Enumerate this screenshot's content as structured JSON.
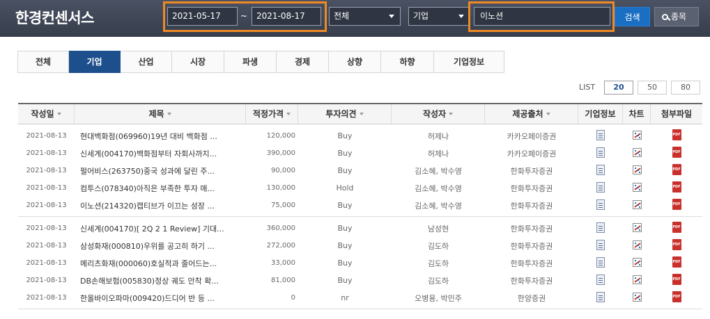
{
  "header": {
    "logo": "한경컨센서스",
    "date_from": "2021-05-17",
    "date_separator": "~",
    "date_to": "2021-08-17",
    "category_select": "전체",
    "type_select": "기업",
    "search_value": "이노션",
    "search_button": "검색",
    "stock_button": "종목"
  },
  "tabs": [
    {
      "label": "전체",
      "active": false
    },
    {
      "label": "기업",
      "active": true
    },
    {
      "label": "산업",
      "active": false
    },
    {
      "label": "시장",
      "active": false
    },
    {
      "label": "파생",
      "active": false
    },
    {
      "label": "경제",
      "active": false
    },
    {
      "label": "상향",
      "active": false
    },
    {
      "label": "하향",
      "active": false
    },
    {
      "label": "기업정보",
      "active": false
    }
  ],
  "list": {
    "label": "LIST",
    "options": [
      "20",
      "50",
      "80"
    ],
    "active": "20"
  },
  "columns": [
    "작성일",
    "제목",
    "적정가격",
    "투자의견",
    "작성자",
    "제공출처",
    "기업정보",
    "차트",
    "첨부파일"
  ],
  "groups": [
    [
      {
        "date": "2021-08-13",
        "title": "현대백화점(069960)19년 대비 백화점 ...",
        "price": "120,000",
        "opinion": "Buy",
        "author": "허제나",
        "source": "카카오페이증권"
      },
      {
        "date": "2021-08-13",
        "title": "신세계(004170)백화점부터 자회사까지...",
        "price": "390,000",
        "opinion": "Buy",
        "author": "허제나",
        "source": "카카오페이증권"
      },
      {
        "date": "2021-08-13",
        "title": "펄어비스(263750)중국 성과에 달린 주...",
        "price": "90,000",
        "opinion": "Buy",
        "author": "김소혜, 박수영",
        "source": "한화투자증권"
      },
      {
        "date": "2021-08-13",
        "title": "컴투스(078340)아직은 부족한 투자 매...",
        "price": "130,000",
        "opinion": "Hold",
        "author": "김소혜, 박수영",
        "source": "한화투자증권"
      },
      {
        "date": "2021-08-13",
        "title": "이노션(214320)캡티브가 이끄는 성장 ...",
        "price": "75,000",
        "opinion": "Buy",
        "author": "김소혜, 박수영",
        "source": "한화투자증권"
      }
    ],
    [
      {
        "date": "2021-08-13",
        "title": "신세계(004170)[ 2Q 2 1 Review] 기대...",
        "price": "360,000",
        "opinion": "Buy",
        "author": "남성현",
        "source": "한화투자증권"
      },
      {
        "date": "2021-08-13",
        "title": "삼성화재(000810)우위를 공고히 하기 ...",
        "price": "272,000",
        "opinion": "Buy",
        "author": "김도하",
        "source": "한화투자증권"
      },
      {
        "date": "2021-08-13",
        "title": "메리츠화재(000060)호실적과 줄어드는...",
        "price": "33,000",
        "opinion": "Buy",
        "author": "김도하",
        "source": "한화투자증권"
      },
      {
        "date": "2021-08-13",
        "title": "DB손해보험(005830)정상 궤도 안착 확...",
        "price": "81,000",
        "opinion": "Buy",
        "author": "김도하",
        "source": "한화투자증권"
      },
      {
        "date": "2021-08-13",
        "title": "한올바이오파마(009420)드디어 반 등 ...",
        "price": "0",
        "opinion": "nr",
        "author": "오병용, 박민주",
        "source": "한양증권"
      }
    ]
  ],
  "icons": {
    "info": "document-icon",
    "chart": "chart-icon",
    "file": "pdf-icon"
  },
  "colors": {
    "header_bg": "#3e4555",
    "highlight": "#f08a24",
    "active_tab": "#1e4f8d",
    "search_button": "#1a6fc2"
  }
}
